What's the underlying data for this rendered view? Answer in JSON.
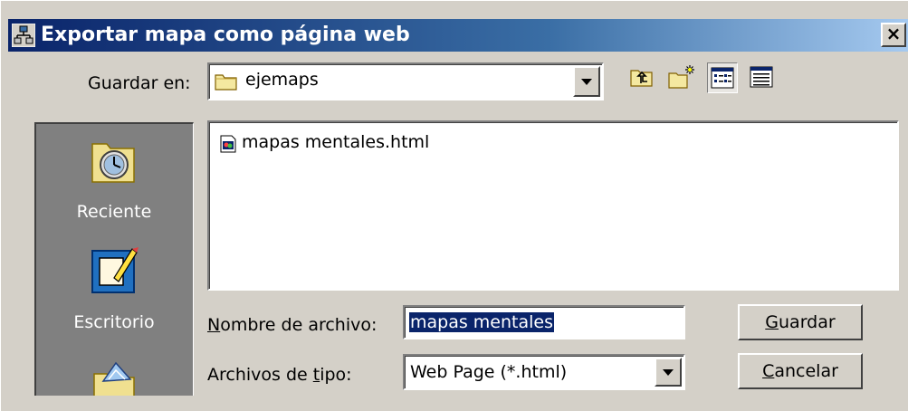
{
  "window": {
    "title": "Exportar mapa como página web",
    "close_label": "×"
  },
  "save_in": {
    "label": "Guardar en:",
    "folder": "ejemaps"
  },
  "toolbar": {
    "icons": [
      "up-one-level-icon",
      "new-folder-icon",
      "list-view-icon",
      "details-view-icon"
    ]
  },
  "places": [
    {
      "label": "Reciente",
      "icon": "recent-icon"
    },
    {
      "label": "Escritorio",
      "icon": "desktop-icon"
    },
    {
      "label": "",
      "icon": "my-documents-icon"
    }
  ],
  "files": [
    {
      "name": "mapas mentales.html",
      "icon": "html-file-icon"
    }
  ],
  "filename": {
    "label_pre": "",
    "label_ul": "N",
    "label_post": "ombre de archivo:",
    "value": "mapas mentales"
  },
  "filetype": {
    "label_pre": "Archivos de ",
    "label_ul": "t",
    "label_post": "ipo:",
    "value": "Web Page (*.html)"
  },
  "buttons": {
    "save_ul": "G",
    "save_rest": "uardar",
    "cancel_ul": "C",
    "cancel_rest": "ancelar"
  },
  "colors": {
    "titlebar_start": "#0a246a",
    "titlebar_end": "#a6caf0",
    "face": "#d4d0c8",
    "selection": "#0a246a"
  }
}
